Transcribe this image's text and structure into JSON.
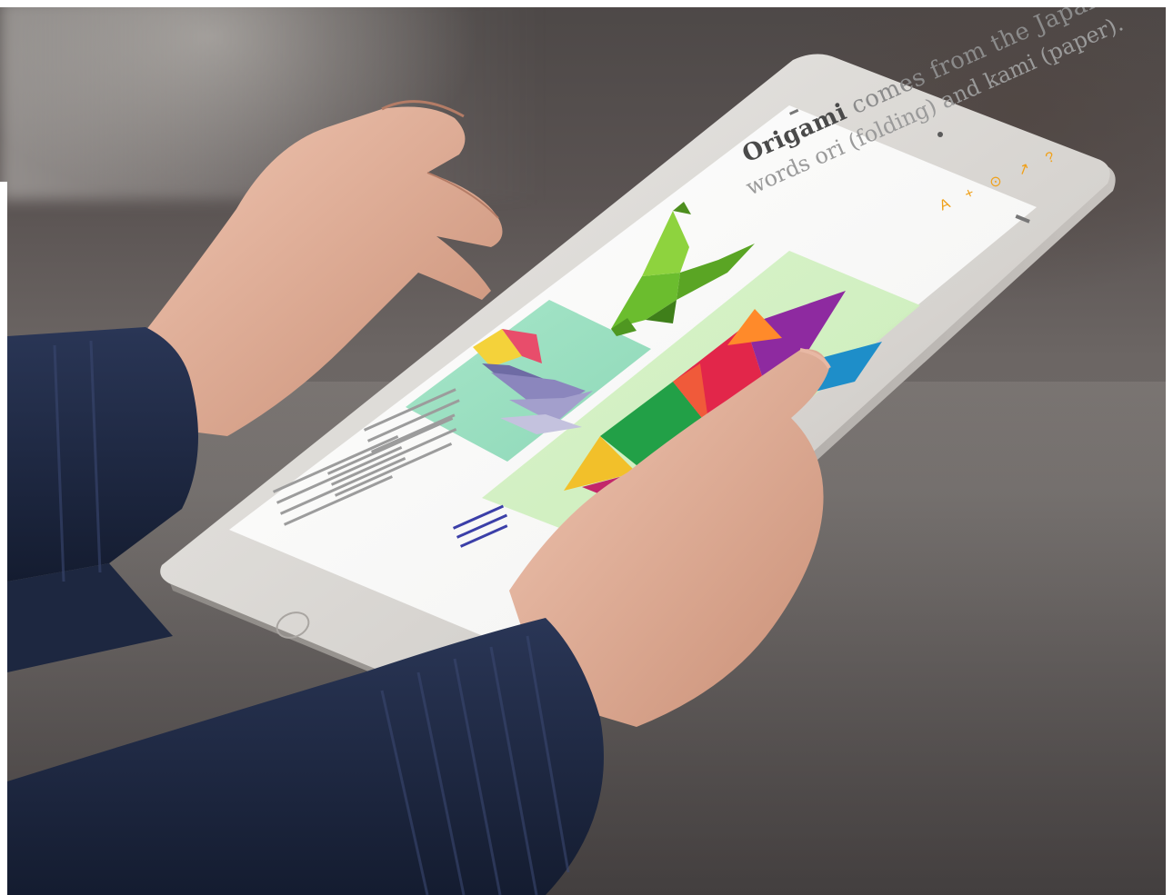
{
  "photo": {
    "subject": "Person holding a tablet displaying an origami article",
    "colors": {
      "background": "#5f5a59",
      "sweater": "#1f2b45",
      "tablet_frame": "#d9d6d2",
      "screen": "#fbfbfa",
      "accent_orange": "#f0a11b",
      "skin": "#d9a68d"
    }
  },
  "screen": {
    "nav_back": "",
    "nav_title": "",
    "heading_word": "Origami",
    "heading_rest": "comes from the Japanese",
    "subheading": "words ori (folding) and kami (paper).",
    "toolbar_tools": "A + ⊙ ↗ ?"
  }
}
